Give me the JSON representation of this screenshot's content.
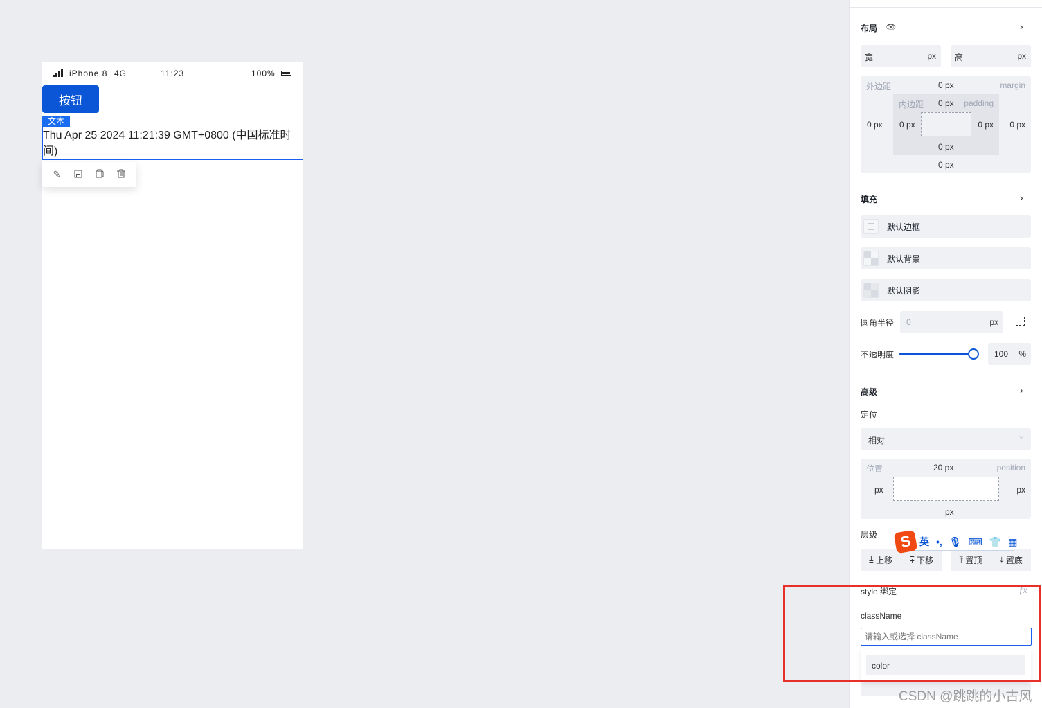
{
  "phone": {
    "signal_icon": "signal-bars-icon",
    "device": "iPhone 8",
    "network": "4G",
    "time": "11:23",
    "battery": "100%",
    "battery_icon": "battery-icon"
  },
  "canvas": {
    "button_label": "按钮",
    "selected_tag": "文本",
    "text_content": "Thu Apr 25 2024 11:21:39 GMT+0800 (中国标准时间)",
    "toolbar_icons": [
      "edit-icon",
      "save-icon",
      "copy-icon",
      "delete-icon"
    ]
  },
  "layout": {
    "title": "布局",
    "width_label": "宽",
    "height_label": "高",
    "unit": "px",
    "margin": {
      "label": "外边距",
      "en": "margin",
      "top": "0 px",
      "left": "0 px",
      "right": "0 px",
      "bottom": "0 px"
    },
    "padding": {
      "label": "内边距",
      "en": "padding",
      "top": "0 px",
      "left": "0 px",
      "right": "0 px",
      "bottom": "0 px"
    }
  },
  "fill": {
    "title": "填充",
    "border": "默认边框",
    "background": "默认背景",
    "shadow": "默认阴影",
    "radius_label": "圆角半径",
    "radius_value": "0",
    "radius_unit": "px",
    "opacity_label": "不透明度",
    "opacity_value": "100",
    "opacity_unit": "%",
    "opacity_percent": 100
  },
  "advanced": {
    "title": "高级",
    "position_label": "定位",
    "position_value": "相对",
    "pos_box": {
      "label": "位置",
      "en": "position",
      "top": "20 px",
      "left": "px",
      "right": "px",
      "bottom": "px"
    },
    "zindex_label": "层级",
    "zindex_buttons": [
      "上移",
      "下移",
      "置顶",
      "置底"
    ]
  },
  "ime": {
    "lang": "英",
    "punct": "•,"
  },
  "style_binding": {
    "title": "style 绑定",
    "fx": "ƒx",
    "classname_label": "className",
    "placeholder": "请输入或选择 className",
    "options": [
      "color"
    ]
  },
  "annotation_color": "#e8302a",
  "watermark": "CSDN @跳跳的小古风"
}
